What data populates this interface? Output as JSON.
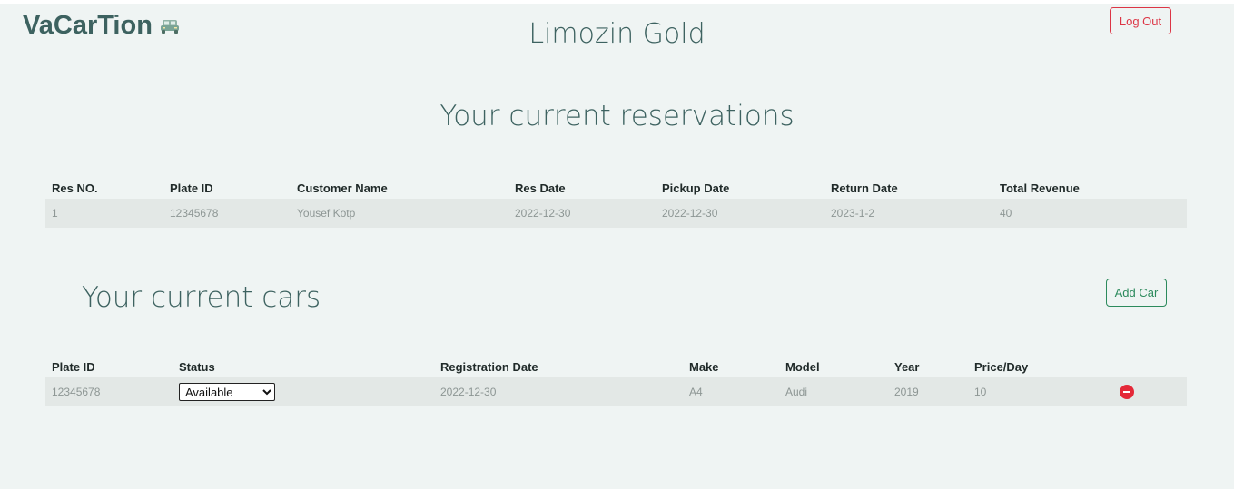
{
  "header": {
    "brand": "VaCarTion",
    "shop_name": "Limozin Gold",
    "logout_label": "Log Out"
  },
  "reservations": {
    "title": "Your current reservations",
    "columns": [
      "Res NO.",
      "Plate ID",
      "Customer Name",
      "Res Date",
      "Pickup Date",
      "Return Date",
      "Total Revenue"
    ],
    "rows": [
      [
        "1",
        "12345678",
        "Yousef Kotp",
        "2022-12-30",
        "2022-12-30",
        "2023-1-2",
        "40"
      ]
    ]
  },
  "cars": {
    "title": "Your current cars",
    "add_label": "Add Car",
    "columns": [
      "Plate ID",
      "Status",
      "Registration Date",
      "Make",
      "Model",
      "Year",
      "Price/Day",
      ""
    ],
    "rows": [
      {
        "plate": "12345678",
        "status": "Available",
        "registration": "2022-12-30",
        "make": "A4",
        "model": "Audi",
        "year": "2019",
        "price": "10"
      }
    ]
  },
  "colors": {
    "accent": "#3d6260",
    "danger": "#dc3545",
    "success": "#2c8a5c",
    "background": "#eff4f3"
  },
  "icons": {
    "brand": "car-icon",
    "remove": "remove-circle-icon"
  }
}
